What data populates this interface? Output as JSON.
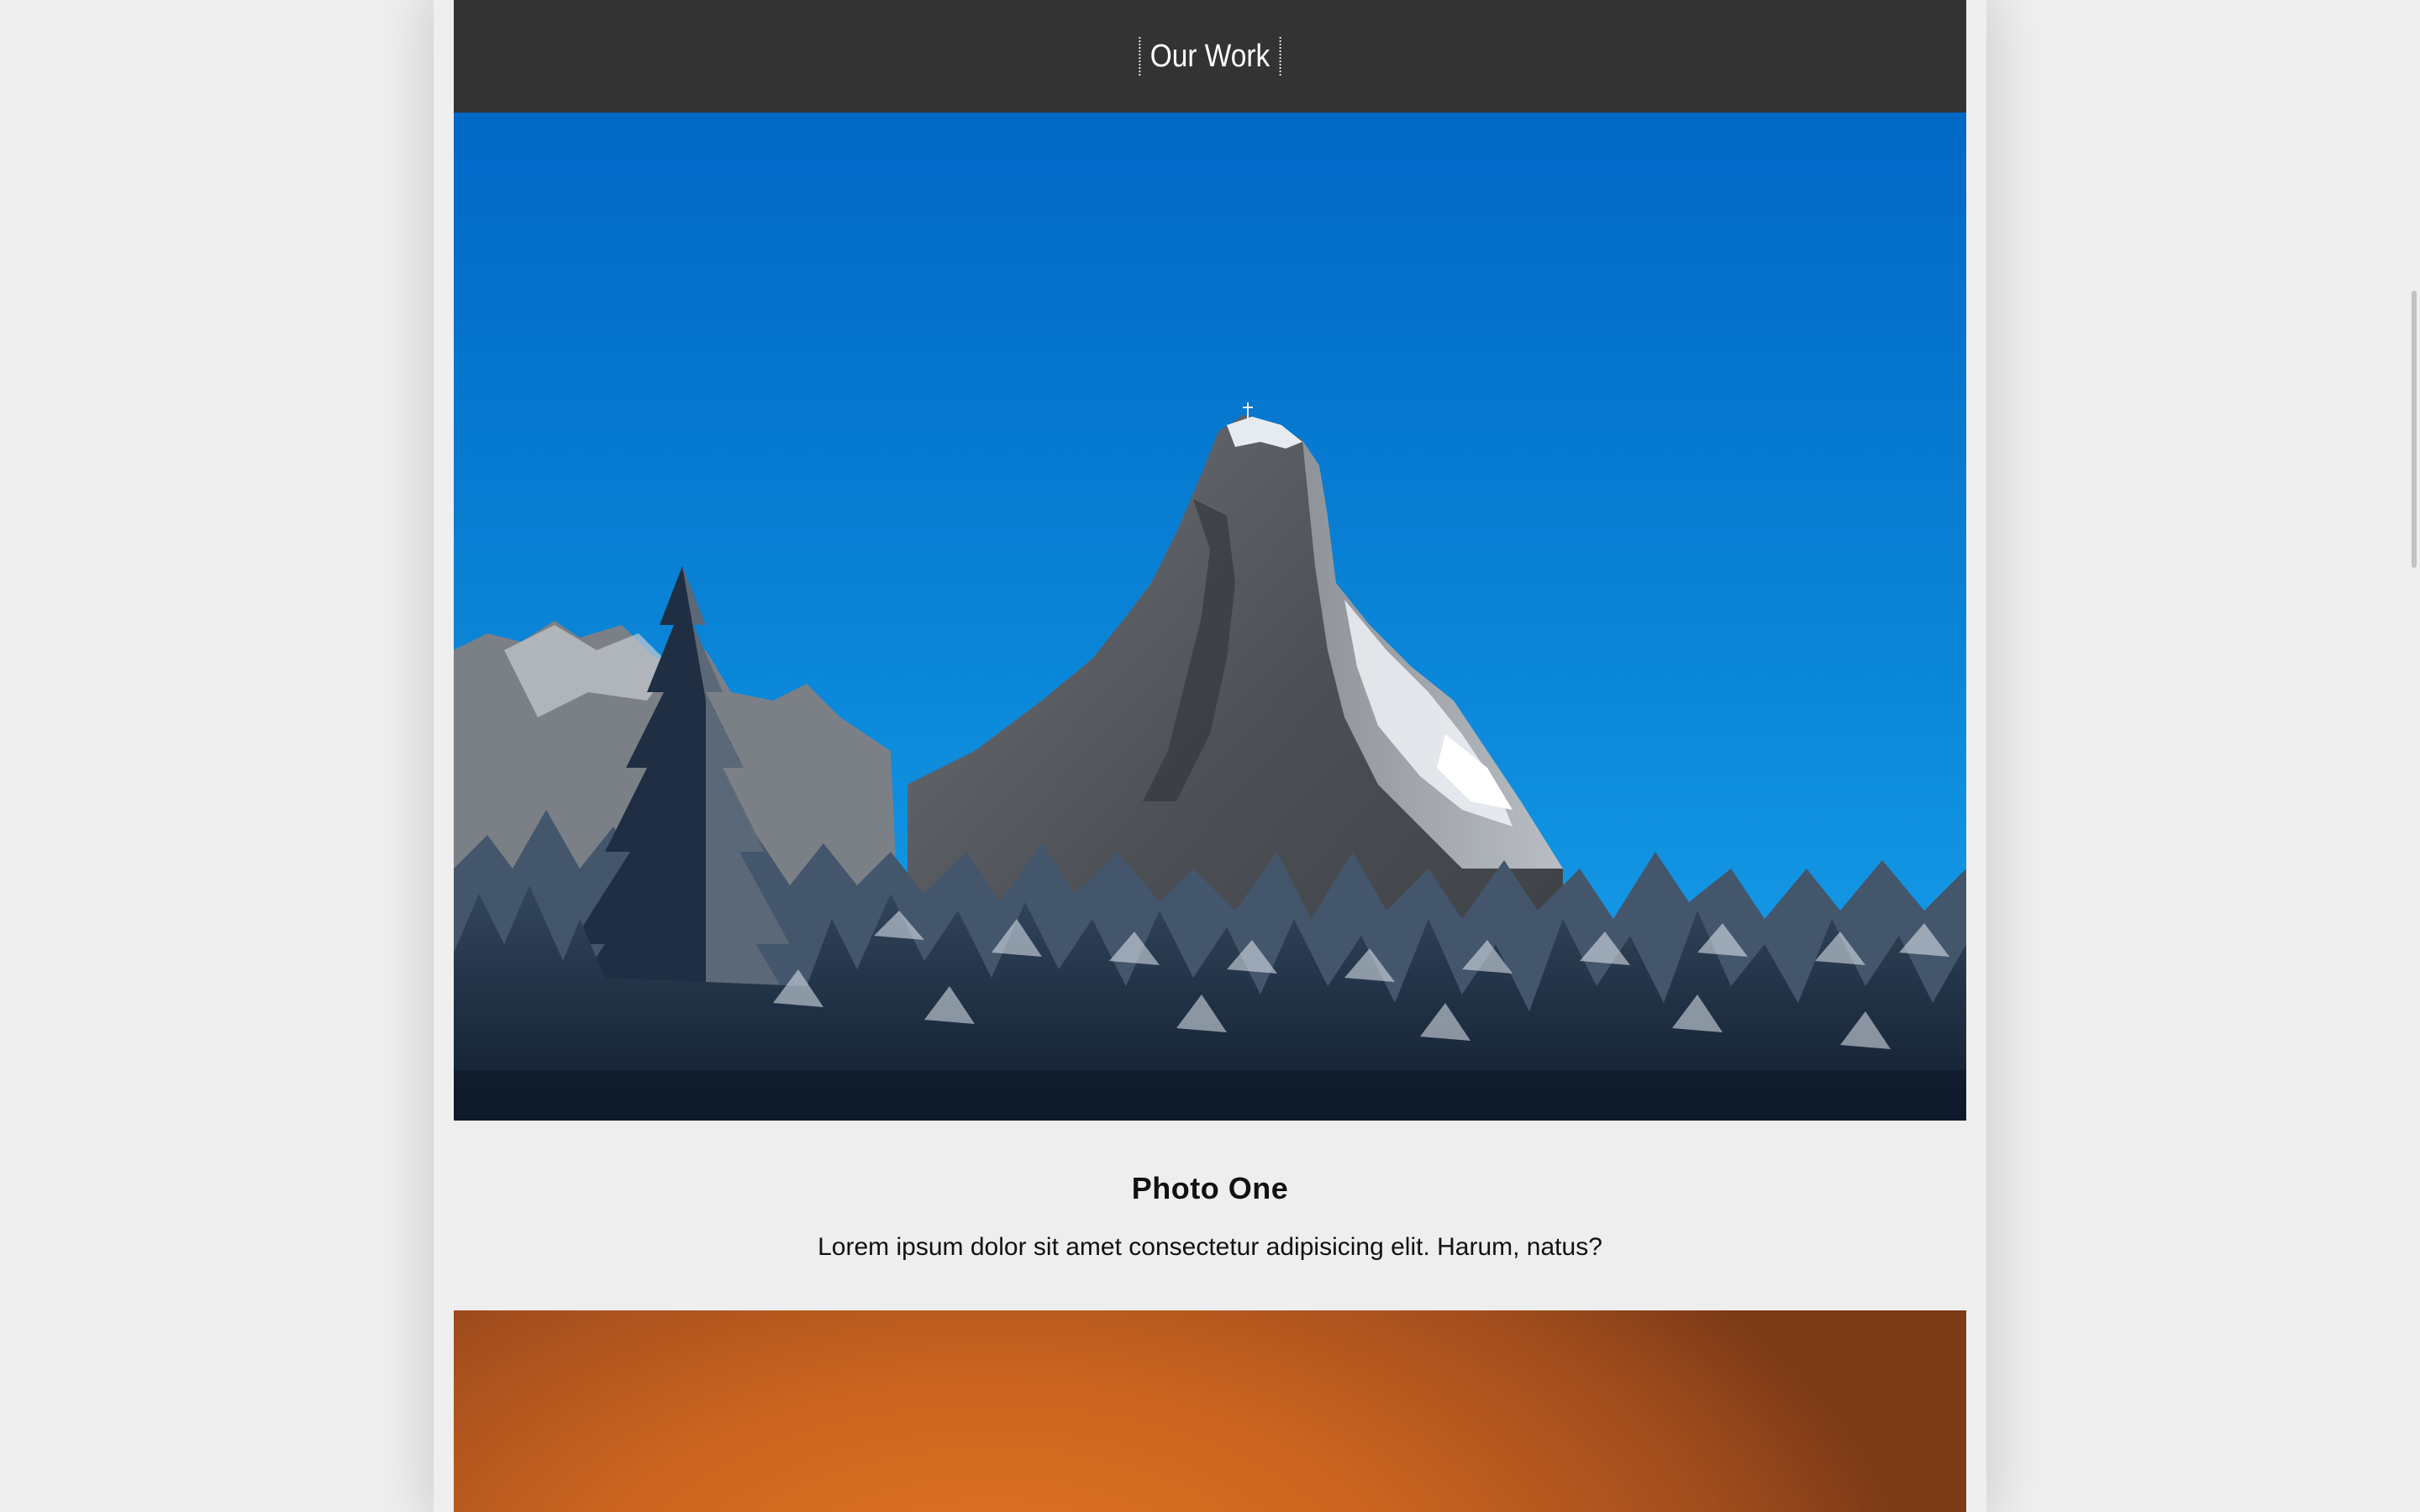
{
  "nav": {
    "link_label": "Our Work"
  },
  "gallery": {
    "items": [
      {
        "title": "Photo One",
        "description": "Lorem ipsum dolor sit amet consectetur adipisicing elit. Harum, natus?",
        "image": "snowy-mountain-peak-with-pine-trees"
      },
      {
        "image": "orange-sunset-gradient"
      }
    ]
  },
  "colors": {
    "page_background": "#efefef",
    "header": "#333333",
    "header_text": "#ffffff",
    "caption_background": "#eeeeee",
    "caption_text": "#111111",
    "sky_blue": "#0a86d8",
    "sunset_orange": "#d86f22"
  }
}
